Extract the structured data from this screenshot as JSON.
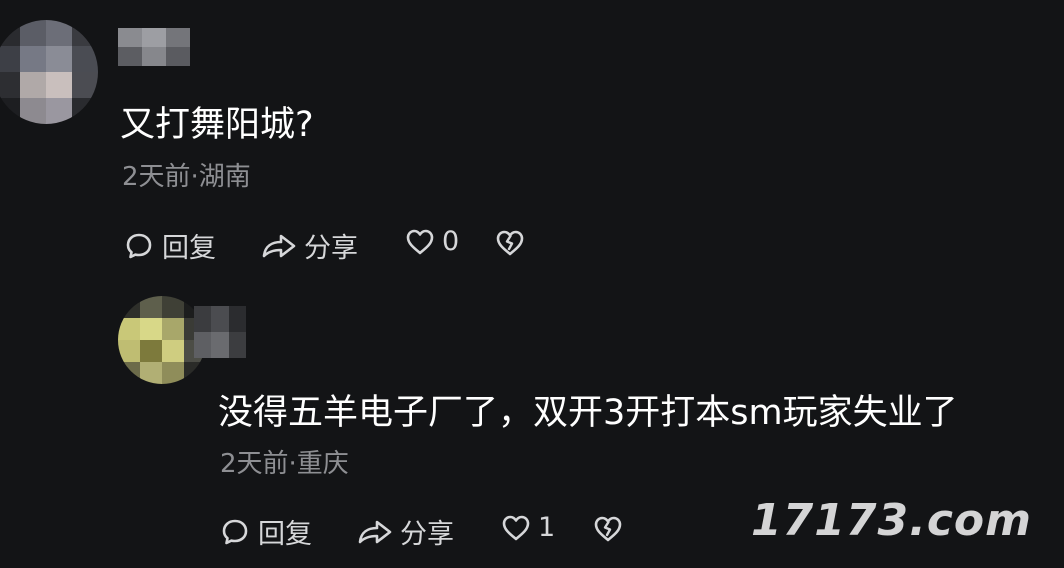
{
  "comments": [
    {
      "text": "又打舞阳城?",
      "meta": "2天前·湖南",
      "reply_label": "回复",
      "share_label": "分享",
      "like_count": "0"
    },
    {
      "text": "没得五羊电子厂了，双开3开打本sm玩家失业了",
      "meta": "2天前·重庆",
      "reply_label": "回复",
      "share_label": "分享",
      "like_count": "1"
    }
  ],
  "watermark": "17173.com",
  "icons": {
    "reply": "comment-bubble-icon",
    "share": "share-arrow-icon",
    "like": "heart-icon",
    "dislike": "broken-heart-icon"
  },
  "colors": {
    "background": "#131416",
    "text": "#ffffff",
    "meta": "#8e8f93",
    "action": "#d6d7d9"
  }
}
